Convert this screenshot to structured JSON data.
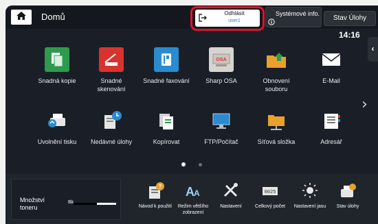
{
  "header": {
    "title": "Domů",
    "logout": {
      "label": "Odhlásit",
      "user": "user1"
    },
    "sysinfo_label": "Systémové info.",
    "jobs_label": "Stav Úlohy",
    "time": "14:16"
  },
  "apps": [
    {
      "label": "Snadná kopie",
      "icon": "copy-icon",
      "color": "#2e9a4e"
    },
    {
      "label": "Snadné skenování",
      "icon": "scan-icon",
      "color": "#d8332f"
    },
    {
      "label": "Snadné faxování",
      "icon": "fax-icon",
      "color": "#2a8bd0"
    },
    {
      "label": "Sharp OSA",
      "icon": "sharp-osa-icon",
      "color": "#d7d4cf"
    },
    {
      "label": "Obnovení souboru",
      "icon": "folder-retrieve-icon",
      "color": "#e9a12c"
    },
    {
      "label": "E-Mail",
      "icon": "email-icon",
      "color": "#ffffff"
    },
    {
      "label": "Uvolnění tisku",
      "icon": "print-release-icon",
      "color": "#2e9a4e"
    },
    {
      "label": "Nedávné úlohy",
      "icon": "recent-jobs-icon",
      "color": "#2a8bd0"
    },
    {
      "label": "Kopírovat",
      "icon": "copy-documents-icon",
      "color": "#ffffff"
    },
    {
      "label": "FTP/Počítač",
      "icon": "computer-icon",
      "color": "#2a8bd0"
    },
    {
      "label": "Síťová složka",
      "icon": "network-folder-icon",
      "color": "#e9a12c"
    },
    {
      "label": "Adresář",
      "icon": "address-book-icon",
      "color": "#ffffff"
    }
  ],
  "pages": {
    "current": 1,
    "total": 2
  },
  "toner": {
    "label": "Množství toneru",
    "color_label": "Bk",
    "level_pct": 55
  },
  "bottom_bar": [
    {
      "label": "Návod k použití",
      "icon": "manual-icon"
    },
    {
      "label": "Režim většího zobrazení",
      "icon": "enlarge-display-icon"
    },
    {
      "label": "Nastavení",
      "icon": "settings-icon"
    },
    {
      "label": "Celkový počet",
      "icon": "total-count-icon"
    },
    {
      "label": "Nastavení jasu",
      "icon": "brightness-icon"
    },
    {
      "label": "Stav úlohy",
      "icon": "job-status-icon"
    }
  ]
}
